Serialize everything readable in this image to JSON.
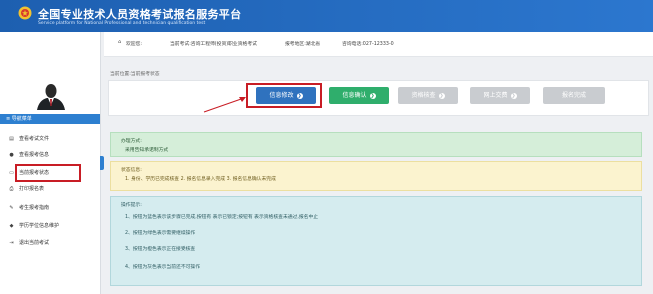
{
  "header": {
    "title": "全国专业技术人员资格考试报名服务平台",
    "subtitle": "Service platform for National Professional and technician qualification test"
  },
  "infobar": {
    "user_label": "欢迎您:",
    "exam_info": "当前考试:咨询工程师(投资)职业资格考试",
    "region_info": "报考地区:湖北省",
    "phone_info": "咨询电话:027-12333-0"
  },
  "location": "当前位置:当前报考状态",
  "steps": [
    {
      "label": "信息修改",
      "arrow": "❯"
    },
    {
      "label": "信息确认",
      "arrow": "❯"
    },
    {
      "label": "资格核查",
      "arrow": "❯"
    },
    {
      "label": "网上交费",
      "arrow": "❯"
    },
    {
      "label": "报名完成"
    }
  ],
  "sidebar": {
    "menu_header": "导航菜单",
    "items": [
      {
        "icon": "file-icon",
        "glyph": "▤",
        "label": "查看考试文件"
      },
      {
        "icon": "info-icon",
        "glyph": "●",
        "label": "查看报考信息"
      },
      {
        "icon": "monitor-icon",
        "glyph": "▭",
        "label": "当前报考状态"
      },
      {
        "icon": "print-icon",
        "glyph": "⎙",
        "label": "打印报名表"
      },
      {
        "icon": "pen-icon",
        "glyph": "✎",
        "label": "考生报考指南"
      },
      {
        "icon": "degree-icon",
        "glyph": "◆",
        "label": "学历学位信息维护"
      },
      {
        "icon": "logout-icon",
        "glyph": "⇥",
        "label": "退出当前考试"
      }
    ]
  },
  "boxes": {
    "method_title": "办理方式:",
    "method_text": "采用告知承诺制方式",
    "status_title": "状态信息:",
    "status_text": "1. 身份、学历已完成核查 2. 报名信息录入完成 3. 报名信息确认未完成",
    "ops_title": "操作提示:",
    "ops_lines": [
      "1、按钮为蓝色表示该步骤已完成,按钮有 表示已锁定;按钮有 表示资格核查未通过,报名中止",
      "2、按钮为绿色表示需要继续操作",
      "3、按钮为橙色表示正在接受核查",
      "4、按钮为灰色表示当前还不可操作"
    ]
  },
  "colors": {
    "header_blue": "#1d5fb0",
    "step_done": "#2f72be",
    "step_active": "#2fae6c",
    "step_disabled": "#c9ccd0",
    "highlight": "#c81d25"
  }
}
